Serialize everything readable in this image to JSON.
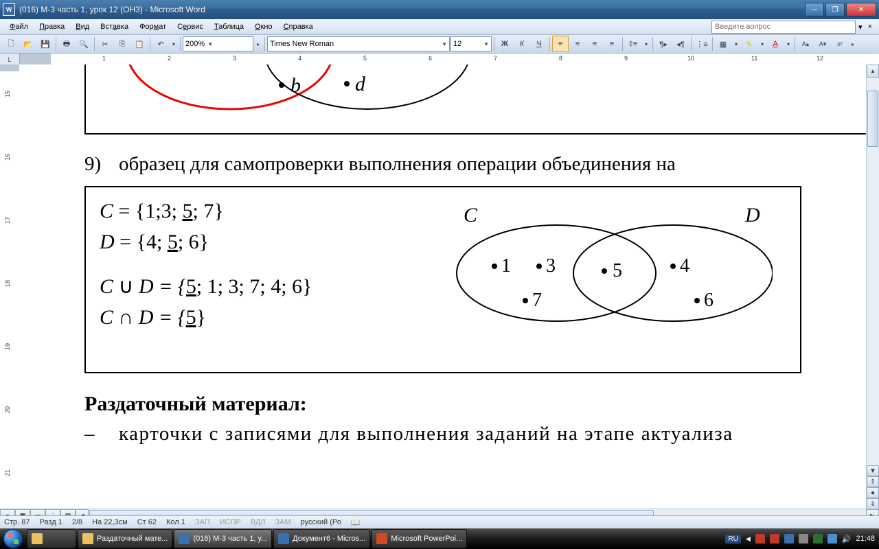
{
  "window": {
    "title": "(016) М-3 часть 1, урок 12 (ОН3) - Microsoft Word",
    "app_icon": "W"
  },
  "menu": {
    "items": [
      "Файл",
      "Правка",
      "Вид",
      "Вставка",
      "Формат",
      "Сервис",
      "Таблица",
      "Окно",
      "Справка"
    ],
    "ask_placeholder": "Введите вопрос"
  },
  "toolbar": {
    "zoom": "200%",
    "font": "Times New Roman",
    "size": "12"
  },
  "ruler": {
    "marks": [
      1,
      2,
      3,
      4,
      5,
      6,
      7,
      8,
      9,
      10,
      11,
      12
    ]
  },
  "vruler": {
    "marks": [
      15,
      16,
      17,
      18,
      19,
      20,
      21
    ]
  },
  "doc": {
    "venn1": {
      "b": "b",
      "d": "d"
    },
    "line9_num": "9)",
    "line9_text": "образец для самопроверки выполнения операции объединения на",
    "math": {
      "l1_pre": "C",
      "l1_post": " = {1;3; ",
      "l1_u": "5",
      "l1_end": "; 7}",
      "l2_pre": "D",
      "l2_post": " = {4; ",
      "l2_u": "5",
      "l2_end": "; 6}",
      "l3_pre": "C ",
      "l3_op": "∪",
      "l3_mid": " D = {",
      "l3_u": "5",
      "l3_end": "; 1; 3; 7; 4; 6}",
      "l4_pre": "C ",
      "l4_op": "∩",
      "l4_mid": " D = {",
      "l4_u": "5",
      "l4_end": "}"
    },
    "venn2": {
      "C": "C",
      "D": "D",
      "p1": "1",
      "p3": "3",
      "p5": "5",
      "p7": "7",
      "p4": "4",
      "p6": "6"
    },
    "h3": "Раздаточный материал:",
    "dash": "–",
    "dash_text": "карточки с записями для выполнения заданий на этапе актуализа"
  },
  "status": {
    "page": "Стр. 87",
    "sect": "Разд 1",
    "pages": "2/8",
    "pos": "На 22,3см",
    "line": "Ст 62",
    "col": "Кол 1",
    "rec": "ЗАП",
    "trk": "ИСПР",
    "ext": "ВДЛ",
    "ovr": "ЗАМ",
    "lang": "русский (Ро"
  },
  "taskbar": {
    "items": [
      {
        "label": "",
        "kind": "explorer"
      },
      {
        "label": "Раздаточный мате...",
        "kind": "folder"
      },
      {
        "label": "(016) М-3 часть 1, у...",
        "kind": "word",
        "active": true
      },
      {
        "label": "Документ6 - Micros...",
        "kind": "word"
      },
      {
        "label": "Microsoft PowerPoi...",
        "kind": "ppt"
      }
    ],
    "lang": "RU",
    "clock": "21:48"
  }
}
